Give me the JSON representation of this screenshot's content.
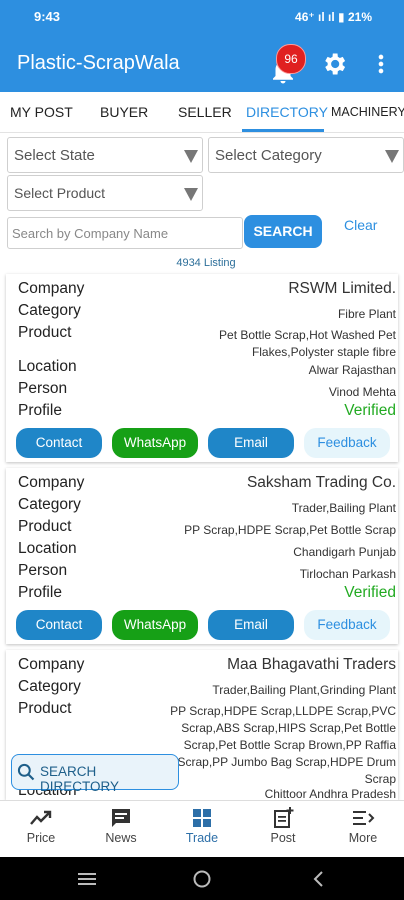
{
  "status": {
    "time": "9:43",
    "signal_left": "46⁺ 4G",
    "right": "46⁺ıll ıll 🔋 21%"
  },
  "appbar": {
    "title": "Plastic-ScrapWala",
    "badge_count": "96"
  },
  "tabs": [
    "MY POST",
    "BUYER",
    "SELLER",
    "DIRECTORY",
    "MACHINERY"
  ],
  "filters": {
    "state_placeholder": "Select State",
    "category_placeholder": "Select Category",
    "product_placeholder": "Select Product",
    "search_placeholder": "Search by Company Name",
    "search_button": "SEARCH",
    "clear": "Clear"
  },
  "listing_count": "4934 Listing",
  "labels": {
    "company": "Company",
    "category": "Category",
    "product": "Product",
    "location": "Location",
    "person": "Person",
    "profile": "Profile"
  },
  "actions": {
    "contact": "Contact",
    "whatsapp": "WhatsApp",
    "email": "Email",
    "feedback": "Feedback"
  },
  "cards": [
    {
      "company": "RSWM Limited.",
      "category": "Fibre Plant",
      "product": "Pet Bottle Scrap,Hot Washed Pet Flakes,Polyster staple fibre",
      "location": "Alwar Rajasthan",
      "person": "Vinod Mehta",
      "profile": "Verified"
    },
    {
      "company": "Saksham Trading Co.",
      "category": "Trader,Bailing Plant",
      "product": "PP Scrap,HDPE Scrap,Pet Bottle Scrap",
      "location": "Chandigarh Punjab",
      "person": "Tirlochan Parkash",
      "profile": "Verified"
    },
    {
      "company": "Maa Bhagavathi Traders",
      "category": "Trader,Bailing Plant,Grinding Plant",
      "product": "PP Scrap,HDPE Scrap,LLDPE Scrap,PVC Scrap,ABS Scrap,HIPS Scrap,Pet Bottle Scrap,Pet Bottle Scrap Brown,PP Raffia Scrap,PP Jumbo Bag Scrap,HDPE Drum Scrap",
      "location": "Chittoor Andhra Pradesh"
    }
  ],
  "float_search": "SEARCH DIRECTORY",
  "bottom_nav": [
    "Price",
    "News",
    "Trade",
    "Post",
    "More"
  ],
  "colors": {
    "primary": "#2d8fe0",
    "whatsapp": "#16a016",
    "verified": "#22aa22",
    "badge": "#e02020"
  }
}
